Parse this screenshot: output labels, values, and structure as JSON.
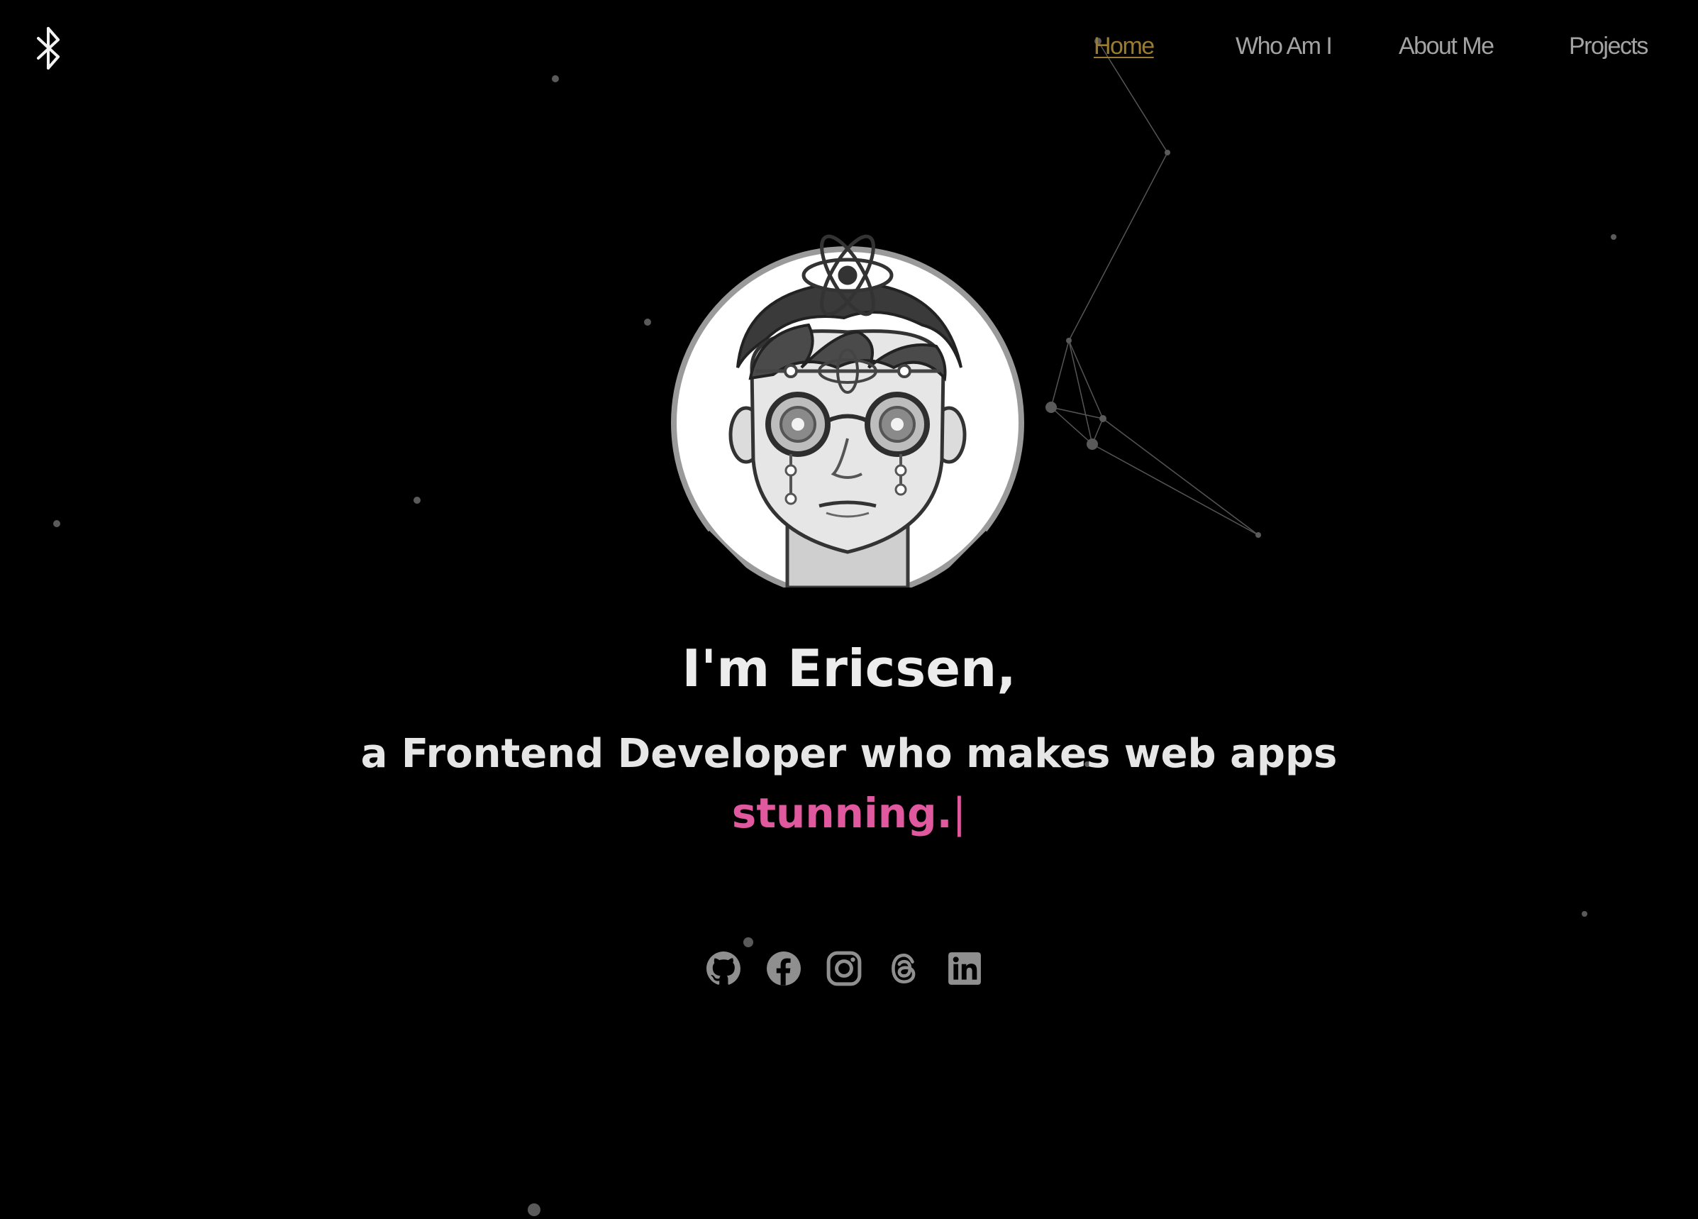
{
  "nav": {
    "items": [
      {
        "label": "Home",
        "active": true
      },
      {
        "label": "Who Am I",
        "active": false
      },
      {
        "label": "About Me",
        "active": false
      },
      {
        "label": "Projects",
        "active": false
      }
    ]
  },
  "logo": {
    "icon": "rune-logo-icon"
  },
  "avatar": {
    "icon": "developer-avatar-illustration"
  },
  "hero": {
    "title": "I'm Ericsen,",
    "subtitle": "a Frontend Developer who makes web apps",
    "typed_word": "stunning.",
    "cursor": "|"
  },
  "socials": [
    {
      "name": "GitHub",
      "icon": "github-icon"
    },
    {
      "name": "Facebook",
      "icon": "facebook-icon"
    },
    {
      "name": "Instagram",
      "icon": "instagram-icon"
    },
    {
      "name": "Threads",
      "icon": "threads-icon"
    },
    {
      "name": "LinkedIn",
      "icon": "linkedin-icon"
    }
  ],
  "colors": {
    "background": "#000000",
    "nav_text": "#a3a3a3",
    "nav_active": "#9b7b2e",
    "accent": "#e0599f",
    "icon": "#8f8f8f"
  }
}
